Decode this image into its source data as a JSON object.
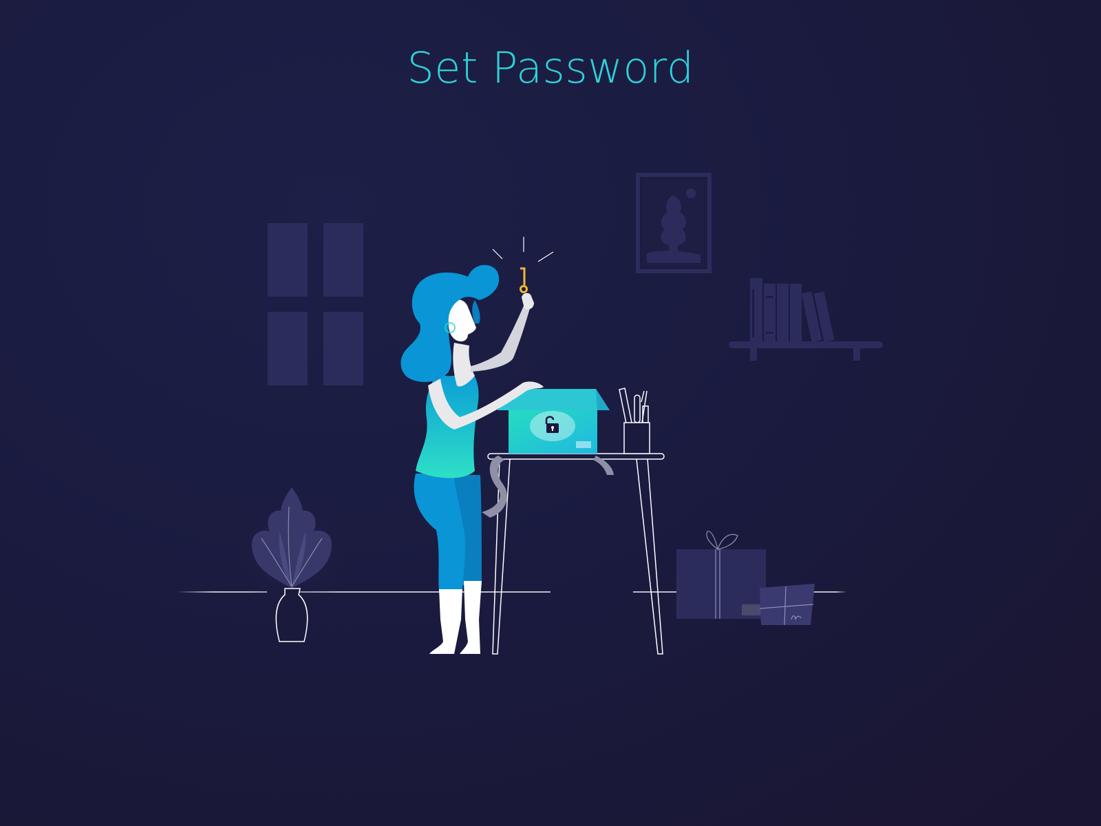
{
  "page": {
    "title": "Set Password"
  },
  "colors": {
    "background": "#1a1a3d",
    "title": "#2fd0d6",
    "accent_teal": "#2ad8c8",
    "accent_blue": "#0a8fd0",
    "key_gold": "#f5b82e",
    "furniture_muted": "#2c2c5c",
    "line_white": "#ffffff"
  },
  "scene": {
    "icons": [
      "window-icon",
      "picture-frame-icon",
      "bookshelf-icon",
      "plant-vase-icon",
      "woman-with-key-icon",
      "key-icon",
      "unlocked-box-icon",
      "padlock-icon",
      "table-icon",
      "pencil-cup-icon",
      "gift-box-icon",
      "small-package-icon"
    ]
  }
}
